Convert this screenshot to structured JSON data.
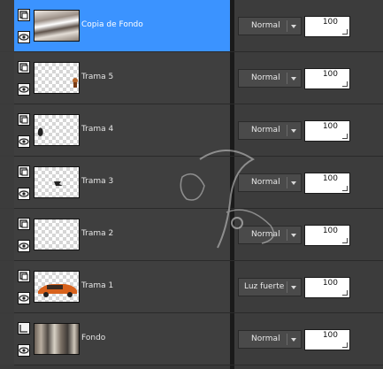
{
  "layers": [
    {
      "name": "Copia de Fondo",
      "blend_mode": "Normal",
      "opacity": "100",
      "selected": true,
      "thumb": "photo",
      "layer_icon": "raster-layer-icon"
    },
    {
      "name": "Trama 5",
      "blend_mode": "Normal",
      "opacity": "100",
      "selected": false,
      "thumb": "transparent-small-figure",
      "layer_icon": "raster-layer-icon"
    },
    {
      "name": "Trama 4",
      "blend_mode": "Normal",
      "opacity": "100",
      "selected": false,
      "thumb": "transparent-dark-figure",
      "layer_icon": "raster-layer-icon"
    },
    {
      "name": "Trama 3",
      "blend_mode": "Normal",
      "opacity": "100",
      "selected": false,
      "thumb": "transparent-center-mark",
      "layer_icon": "raster-layer-icon"
    },
    {
      "name": "Trama 2",
      "blend_mode": "Normal",
      "opacity": "100",
      "selected": false,
      "thumb": "transparent",
      "layer_icon": "raster-layer-icon"
    },
    {
      "name": "Trama 1",
      "blend_mode": "Luz fuerte",
      "opacity": "100",
      "selected": false,
      "thumb": "transparent-orange-car",
      "layer_icon": "raster-layer-icon"
    },
    {
      "name": "Fondo",
      "blend_mode": "Normal",
      "opacity": "100",
      "selected": false,
      "thumb": "photo-background",
      "layer_icon": "background-layer-icon"
    }
  ],
  "icons": {
    "visibility": "eye-icon",
    "dropdown": "chevron-down-icon"
  },
  "colors": {
    "selected_row": "#3b93ff",
    "row_bg": "#3f3f3f",
    "opacity_field_bg": "#ffffff"
  }
}
